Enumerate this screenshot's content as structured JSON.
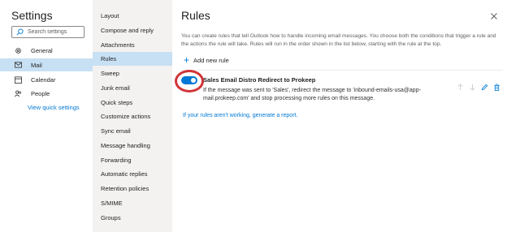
{
  "settings": {
    "title": "Settings",
    "search_placeholder": "Search settings",
    "nav": [
      {
        "label": "General",
        "icon": "gear-icon"
      },
      {
        "label": "Mail",
        "icon": "mail-icon"
      },
      {
        "label": "Calendar",
        "icon": "calendar-icon"
      },
      {
        "label": "People",
        "icon": "people-icon"
      }
    ],
    "view_quick_settings": "View quick settings"
  },
  "mail_nav": {
    "items": [
      "Layout",
      "Compose and reply",
      "Attachments",
      "Rules",
      "Sweep",
      "Junk email",
      "Quick steps",
      "Customize actions",
      "Sync email",
      "Message handling",
      "Forwarding",
      "Automatic replies",
      "Retention policies",
      "S/MIME",
      "Groups"
    ]
  },
  "rules": {
    "title": "Rules",
    "description": "You can create rules that tell Outlook how to handle incoming email messages. You choose both the conditions that trigger a rule and the actions the rule will take. Rules will run in the order shown in the list below, starting with the rule at the top.",
    "add_new_rule": "Add new rule",
    "rule": {
      "name": "Sales Email Distro Redirect to Prokeep",
      "description": "If the message was sent to 'Sales', redirect the message to 'inbound-emails-usa@app-mail.prokeep.com' and stop processing more rules on this message.",
      "enabled": true
    },
    "report_link": "If your rules aren't working, generate a report."
  },
  "colors": {
    "accent": "#0078d4",
    "selected_bg": "#c7e0f4",
    "highlight_ring": "#d13438"
  }
}
